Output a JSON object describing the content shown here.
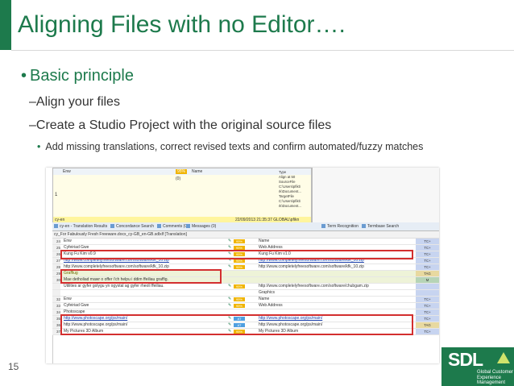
{
  "slide": {
    "title": "Aligning Files with no Editor….",
    "bullet_main": "Basic principle",
    "sub1": "–Align your files",
    "sub2": "–Create a Studio Project with the original source files",
    "sub3": "Add missing translations, correct revised texts and confirm automated/fuzzy matches",
    "page_number": "15"
  },
  "screenshot": {
    "tm": {
      "source": "Enw",
      "percent": "95%",
      "target_header": "Name",
      "row_num": "1",
      "source_row": "(0)",
      "meta_lines": [
        "Type",
        "Align at 50",
        "SourceFile",
        "C:\\Users\\pfikt\\",
        "rk\\Document...",
        "TargetFile",
        "C:\\Users\\pfikt\\",
        "rk\\Document..."
      ],
      "footer_left": "cy-en",
      "footer_right": "22/09/2013 21:35:37  GLOBAL\\pfikn"
    },
    "tabs": [
      "cy-en - Translation Results",
      "Concordance Search",
      "Comments (0)",
      "Messages (0)",
      "Term Recognition",
      "Termbase Search"
    ],
    "doc_title": "cy_For Fabulously Fresh Freeware.docx_cy-GB_en-GB.sdlxlf [Translation]",
    "rows": [
      {
        "num": "24",
        "source": "Enw",
        "status": "95%",
        "target": "Name",
        "badge": "TC+"
      },
      {
        "num": "25",
        "source": "Cyfeiriad Gwe",
        "status": "95%",
        "target": "Web Address",
        "badge": "TC+"
      },
      {
        "num": "26",
        "source": "Kung Fu Kim v0.9",
        "status": "95%",
        "target": "Kung Fu Kim v1.0",
        "badge": "TC+"
      },
      {
        "num": "27",
        "source": "http://www.completelyfreesoftware.com/software/kfk_10.zip",
        "status": "95%",
        "target": "http://www.completelyfreesoftware.com/software/kfk_10.zip",
        "badge": "TC+"
      },
      {
        "num": "28",
        "source": "http://www.completelyfreesoftware.com/software/kfk_10.zip",
        "status": "95%",
        "target": "http://www.completelyfreesoftware.com/software/kfk_10.zip",
        "badge": "TC+"
      },
      {
        "num": "29",
        "source": "Graffiug",
        "status": "",
        "target": "",
        "badge": "TAG"
      },
      {
        "num": "30",
        "source": "Mae detholiad mawr o offer i'ch helpu i ddim ffeiliau graffig.",
        "status": "",
        "target": "",
        "badge": "M"
      },
      {
        "num": "",
        "source": "Utilities ar gyfer golygu yn ogystal ag gyfer rheoli ffeiliau.",
        "status": "95%",
        "target": "http://www.completelyfreesoftware.com/software/chubgam.zip",
        "badge": ""
      },
      {
        "num": "",
        "source": "",
        "status": "",
        "target": "Graphics",
        "badge": ""
      },
      {
        "num": "32",
        "source": "Enw",
        "status": "95%",
        "target": "Name",
        "badge": "TC+"
      },
      {
        "num": "33",
        "source": "Cyfeiriad Gwe",
        "status": "95%",
        "target": "Web Address",
        "badge": "TC+"
      },
      {
        "num": "34",
        "source": "Photoscape",
        "status": "",
        "target": "",
        "badge": "TC+"
      },
      {
        "num": "35",
        "source": "http://www.photoscape.org/ps/main/",
        "status": "AT",
        "target": "http://www.photoscape.org/ps/main/",
        "badge": "TC+"
      },
      {
        "num": "36",
        "source": "http://www.photoscape.org/ps/main/",
        "status": "AT",
        "target": "http://www.photoscape.org/ps/main/",
        "badge": "TAG"
      },
      {
        "num": "37",
        "source": "My Pictures 3D Album",
        "status": "95%",
        "target": "My Pictures 3D Album",
        "badge": "TC+"
      }
    ]
  },
  "logo": {
    "brand": "SDL",
    "tagline1": "Global Customer",
    "tagline2": "Experience Management"
  }
}
